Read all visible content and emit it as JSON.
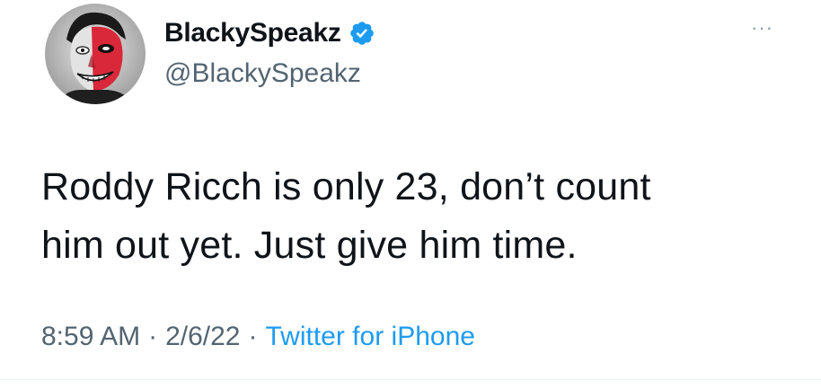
{
  "author": {
    "display_name": "BlackySpeakz",
    "handle": "@BlackySpeakz",
    "verified": true,
    "verified_icon": "verified-badge-icon",
    "avatar_icon": "avatar"
  },
  "tweet": {
    "text_line1": "Roddy Ricch is only 23, don’t count",
    "text_line2": "him out yet. Just give him time.",
    "time": "8:59 AM",
    "separator": "·",
    "date": "2/6/22",
    "source": "Twitter for iPhone",
    "more_label": "···"
  },
  "colors": {
    "text": "#0f1419",
    "secondary": "#536471",
    "accent": "#1d9bf0"
  }
}
